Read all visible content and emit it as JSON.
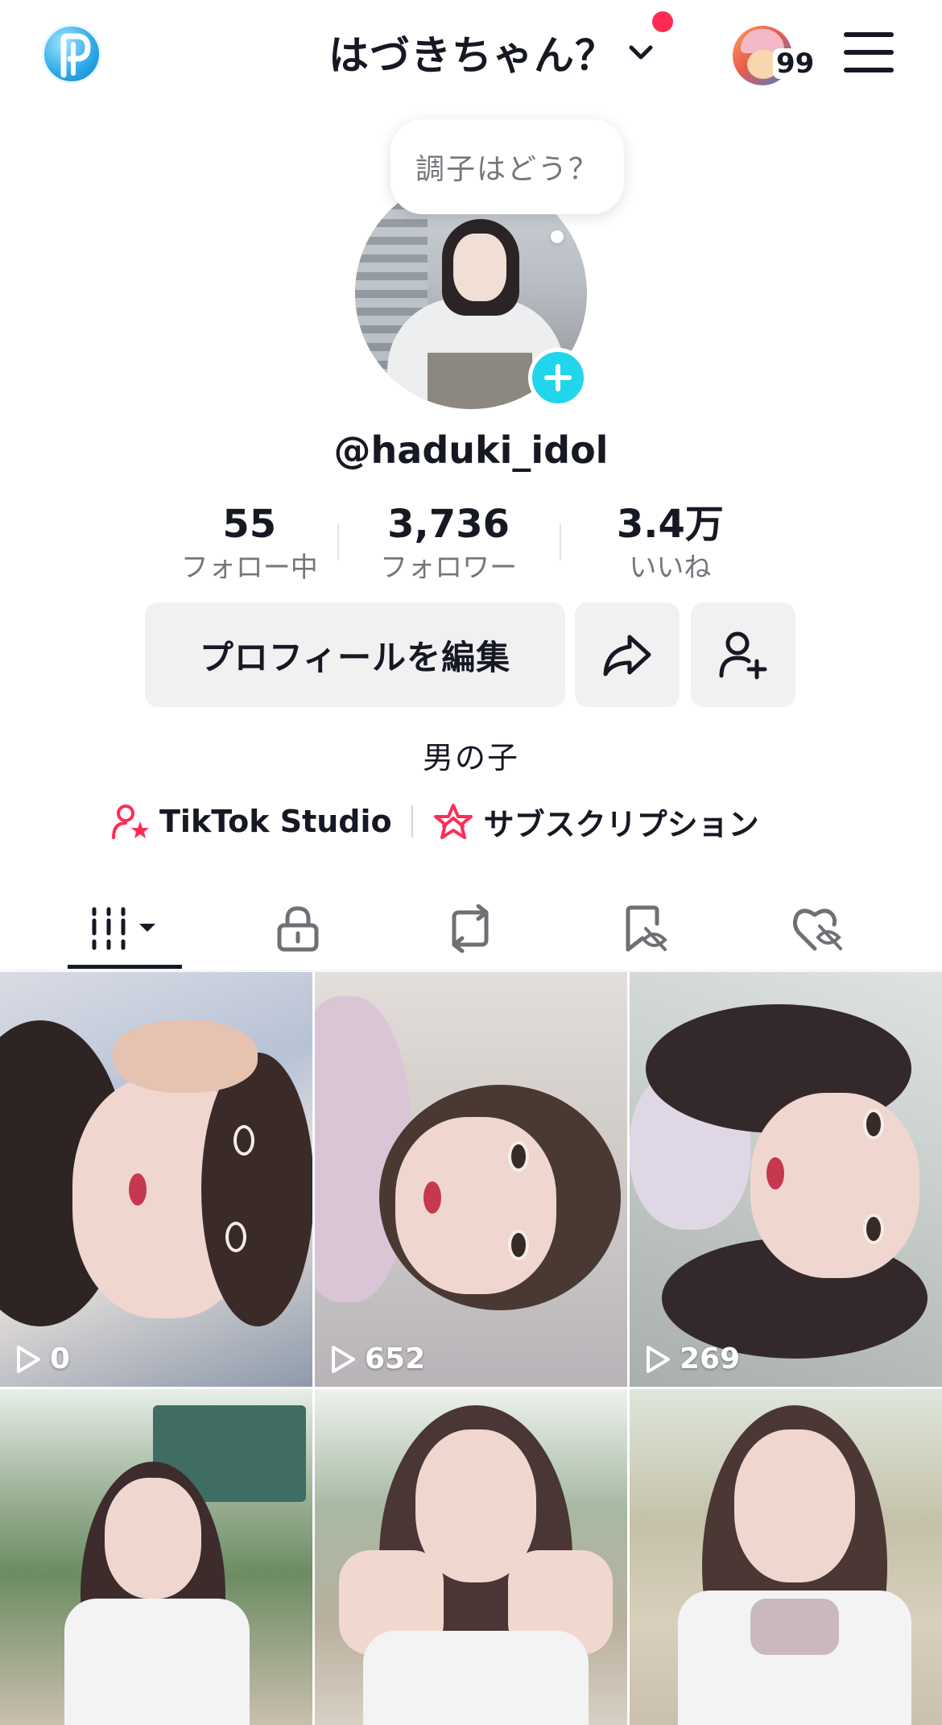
{
  "header": {
    "title": "はづきちゃん？",
    "friends_count": "99"
  },
  "profile": {
    "status_bubble": "調子はどう？",
    "username": "@haduki_idol",
    "bio": "男の子"
  },
  "stats": [
    {
      "value": "55",
      "label": "フォロー中"
    },
    {
      "value": "3,736",
      "label": "フォロワー"
    },
    {
      "value": "3.4万",
      "label": "いいね"
    }
  ],
  "actions": {
    "edit_profile": "プロフィールを編集"
  },
  "links": {
    "studio": "TikTok Studio",
    "subscription": "サブスクリプション"
  },
  "tabs": [
    {
      "name": "videos",
      "icon": "grid-icon",
      "active": true
    },
    {
      "name": "private",
      "icon": "lock-icon",
      "active": false
    },
    {
      "name": "reposts",
      "icon": "repost-icon",
      "active": false
    },
    {
      "name": "favorites",
      "icon": "bookmark-hidden-icon",
      "active": false
    },
    {
      "name": "liked",
      "icon": "heart-hidden-icon",
      "active": false
    }
  ],
  "videos": [
    {
      "views": "0"
    },
    {
      "views": "652"
    },
    {
      "views": "269"
    },
    {
      "views": ""
    },
    {
      "views": ""
    },
    {
      "views": ""
    }
  ],
  "colors": {
    "accent_cyan": "#20d5ec",
    "accent_red": "#fe2c55",
    "button_bg": "#f1f1f2"
  }
}
